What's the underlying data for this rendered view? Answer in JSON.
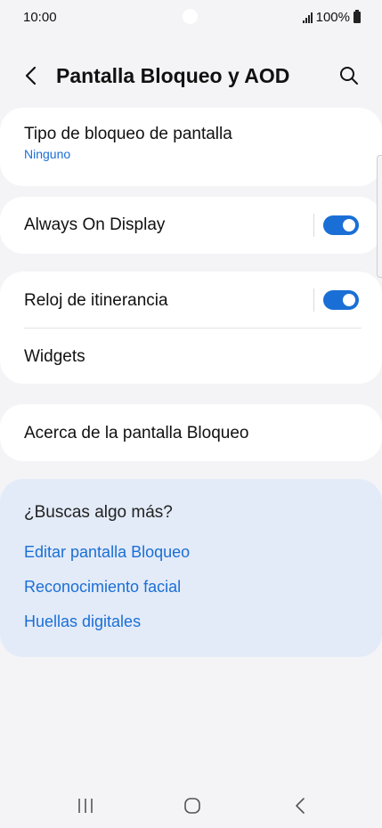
{
  "status_bar": {
    "time": "10:00",
    "battery": "100%",
    "signal_icon": "signal-icon",
    "battery_icon": "battery-icon"
  },
  "header": {
    "title": "Pantalla Bloqueo y AOD",
    "back_icon": "chevron-left-icon",
    "search_icon": "search-icon"
  },
  "settings": {
    "lock_type": {
      "title": "Tipo de bloqueo de pantalla",
      "value": "Ninguno"
    },
    "aod": {
      "title": "Always On Display",
      "enabled": true
    },
    "roaming_clock": {
      "title": "Reloj de itinerancia",
      "enabled": true
    },
    "widgets": {
      "title": "Widgets"
    },
    "about": {
      "title": "Acerca de la pantalla Bloqueo"
    }
  },
  "suggestions": {
    "title": "¿Buscas algo más?",
    "links": [
      "Editar pantalla Bloqueo",
      "Reconocimiento facial",
      "Huellas digitales"
    ]
  },
  "nav": {
    "recents_icon": "recents-icon",
    "home_icon": "home-icon",
    "back_icon": "back-icon"
  },
  "colors": {
    "accent": "#1a6fd6",
    "background": "#f4f4f7",
    "card": "#ffffff",
    "suggest_bg": "#e3ebf8"
  }
}
